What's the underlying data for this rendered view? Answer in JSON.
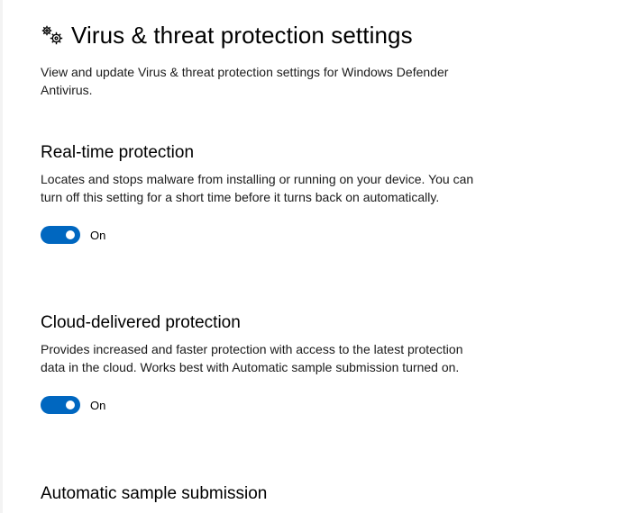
{
  "header": {
    "icon": "gears-icon",
    "title": "Virus & threat protection settings",
    "description": "View and update Virus & threat protection settings for Windows Defender Antivirus."
  },
  "sections": [
    {
      "title": "Real-time protection",
      "description": "Locates and stops malware from installing or running on your device. You can turn off this setting for a short time before it turns back on automatically.",
      "toggle": {
        "state": "on",
        "label": "On"
      }
    },
    {
      "title": "Cloud-delivered protection",
      "description": "Provides increased and faster protection with access to the latest protection data in the cloud. Works best with Automatic sample submission turned on.",
      "toggle": {
        "state": "on",
        "label": "On"
      }
    },
    {
      "title": "Automatic sample submission"
    }
  ],
  "colors": {
    "accent": "#0067c0",
    "text": "#000000",
    "background": "#ffffff"
  }
}
